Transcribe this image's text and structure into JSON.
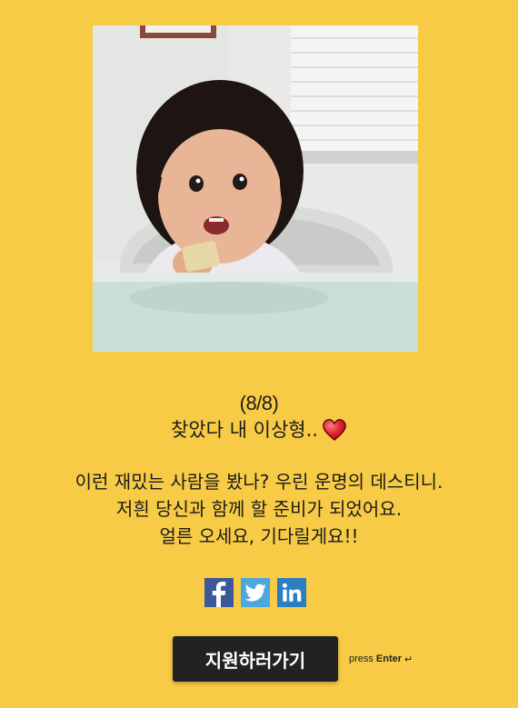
{
  "photo": {
    "alt": "toddler with curly hair holding a cracker"
  },
  "message": {
    "progress": "(8/8)",
    "title": "찾았다 내 이상형..",
    "lines": [
      "이런 재밌는 사람을 봤나? 우린 운명의 데스티니.",
      "저흰 당신과 함께 할 준비가 되었어요.",
      "얼른 오세요, 기다릴게요!!"
    ]
  },
  "social": {
    "icons": [
      "facebook-icon",
      "twitter-icon",
      "linkedin-icon"
    ],
    "colors": {
      "facebook": "#3b5998",
      "twitter": "#4da7de",
      "linkedin": "#2a7fc0"
    }
  },
  "cta": {
    "label": "지원하러가기",
    "hint_prefix": "press",
    "hint_key": "Enter",
    "hint_symbol": "↵"
  },
  "colors": {
    "background": "#f7cb45",
    "button": "#222222",
    "heart": "#e0232f"
  }
}
